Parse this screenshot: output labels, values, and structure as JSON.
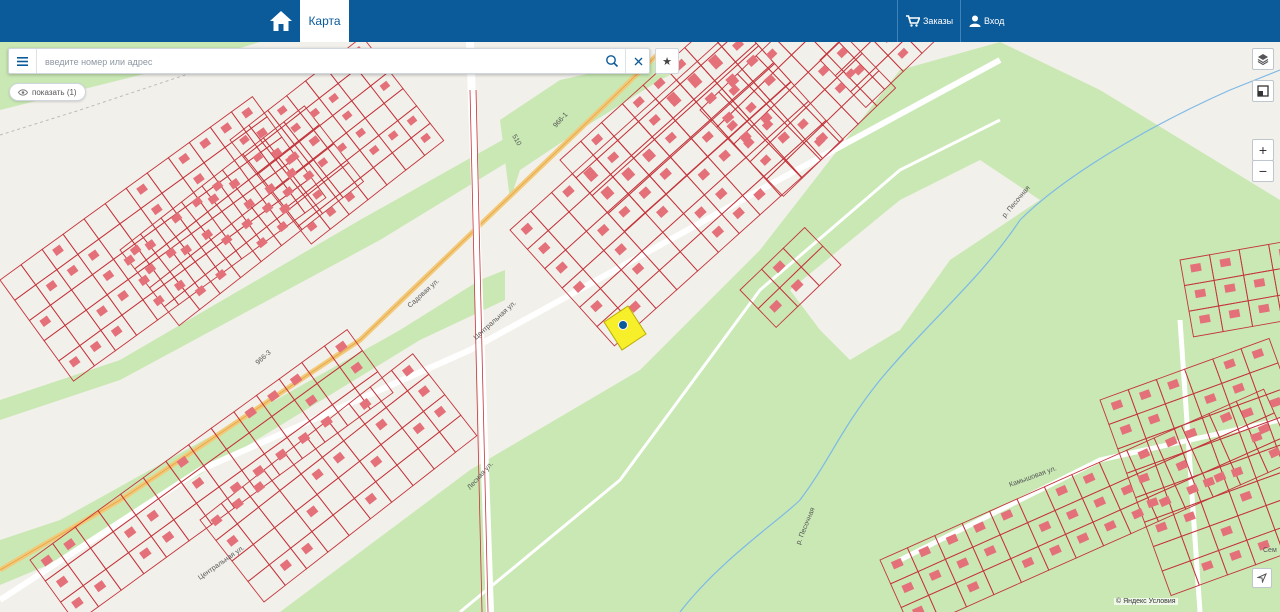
{
  "header": {
    "tab_map": "Карта",
    "orders_label": "Заказы",
    "login_label": "Вход"
  },
  "search": {
    "placeholder": "введите номер или адрес"
  },
  "show_button": {
    "label": "показать (1)"
  },
  "controls": {
    "zoom_in": "+",
    "zoom_out": "−"
  },
  "streets": {
    "central": "Центральная ул.",
    "lesnaya": "Лесная ул.",
    "sadovaya": "Садовая ул.",
    "kamyshovaya": "Камышовая ул.",
    "river": "р. Песочная",
    "road_966_3": "966-3",
    "road_966_1": "966-1",
    "road_510": "510",
    "semy": "Сем"
  },
  "copyright": "© Яндекс Условия"
}
